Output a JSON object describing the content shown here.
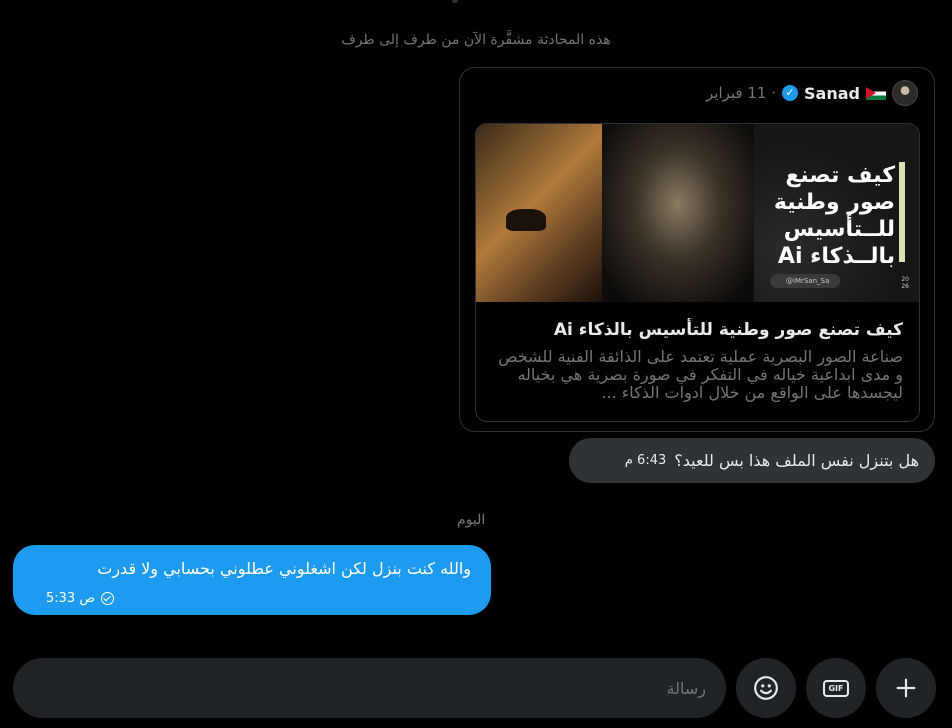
{
  "conversation": {
    "encryption_note": "هذه المحادثة مشفَّرة الآن من طرف إلى طرف"
  },
  "shared_post": {
    "author_name": "Sanad",
    "date": "· 11 فبراير",
    "article": {
      "image_title_lines": [
        "كيف تصنع",
        "صور وطنية",
        "للــتأسيس",
        "بالــذكاء Ai"
      ],
      "image_handle": "@iMrSan_Sa",
      "image_year": "20\n26",
      "title": "كيف تصنع صور وطنية للتأسيس بالذكاء Ai",
      "description": "صناعة الصور البصرية عملية تعتمد على الذائقة الفنية للشخص و مدى ابداعية خياله في التفكر في صورة بصرية هي بخياله ليجسدها على الواقع من خلال ادوات الذكاء ..."
    }
  },
  "messages": [
    {
      "text": "هل بتنزل نفس الملف هذا بس للعيد؟",
      "time": "6:43 م"
    },
    {
      "text": "والله كنت بنزل لكن اشغلوني عطلوني بحسابي ولا قدرت",
      "time": "5:33 ص"
    }
  ],
  "day_separator": "اليوم",
  "composer": {
    "placeholder": "رسالة",
    "gif_label": "GIF"
  },
  "colors": {
    "accent": "#1d9bf0",
    "incoming_bubble": "#2f3336",
    "background": "#000000"
  }
}
